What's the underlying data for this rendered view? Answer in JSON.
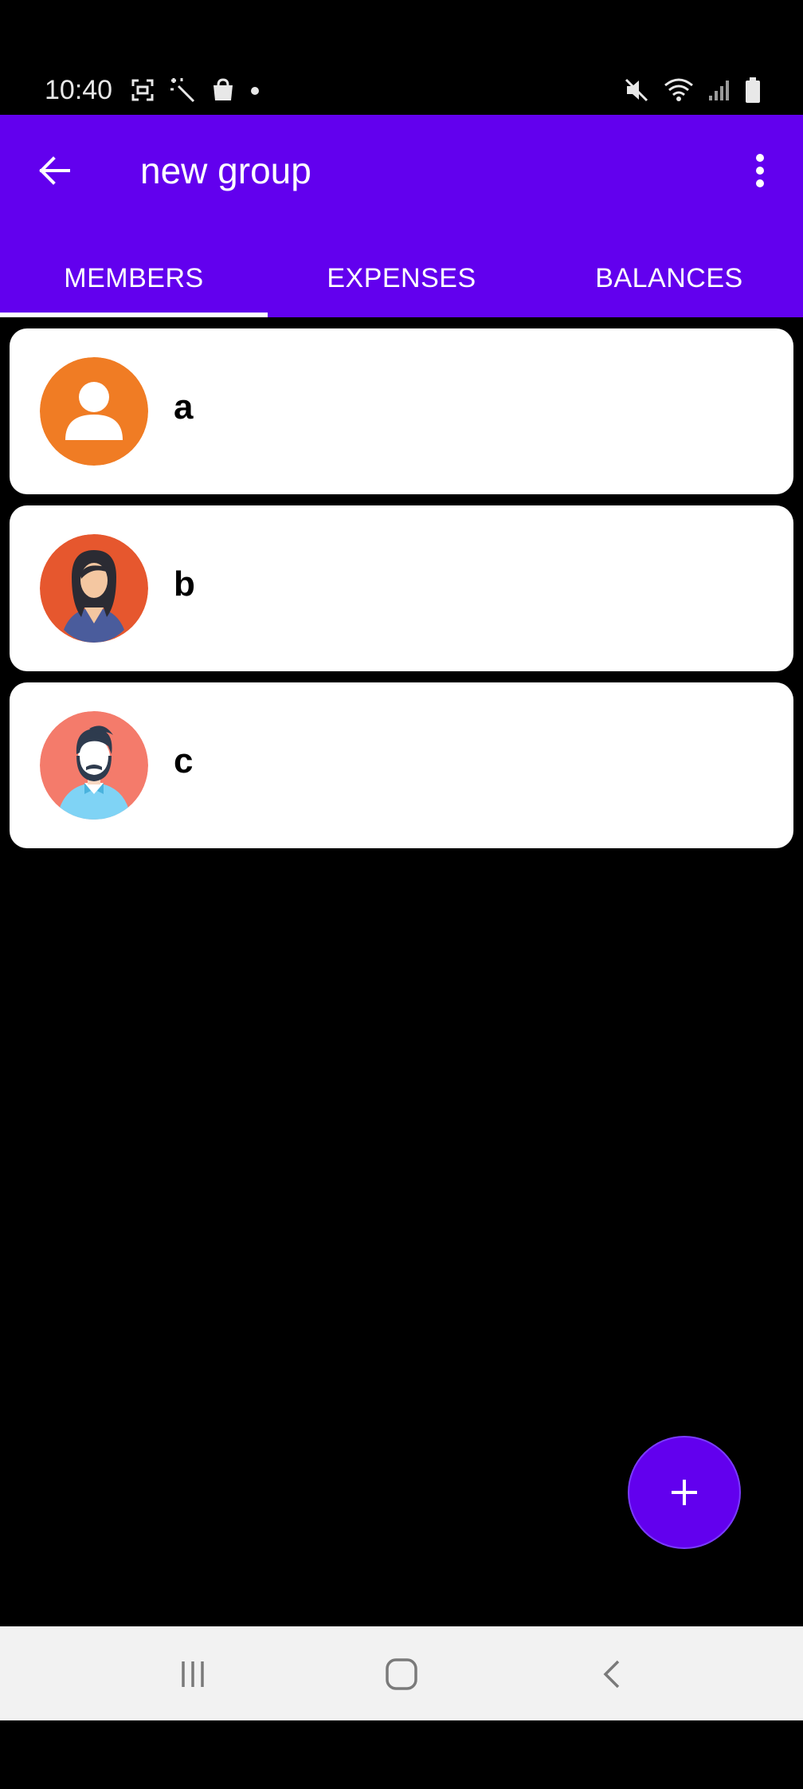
{
  "status_bar": {
    "time": "10:40",
    "left_icons": [
      "screenshot-icon",
      "magic-wand-icon",
      "shopping-bag-icon",
      "dot-icon"
    ],
    "right_icons": [
      "mute-icon",
      "wifi-icon",
      "signal-icon",
      "battery-icon"
    ]
  },
  "app_bar": {
    "title": "new group",
    "accent_color": "#6200ee"
  },
  "tabs": [
    {
      "label": "MEMBERS",
      "active": true
    },
    {
      "label": "EXPENSES",
      "active": false
    },
    {
      "label": "BALANCES",
      "active": false
    }
  ],
  "members": [
    {
      "name": "a",
      "avatar": "default-user-avatar"
    },
    {
      "name": "b",
      "avatar": "woman-avatar"
    },
    {
      "name": "c",
      "avatar": "bearded-man-avatar"
    }
  ],
  "fab": {
    "icon": "plus-icon"
  },
  "nav_bar": {
    "icons": [
      "recent-apps-icon",
      "home-icon",
      "back-icon"
    ]
  }
}
